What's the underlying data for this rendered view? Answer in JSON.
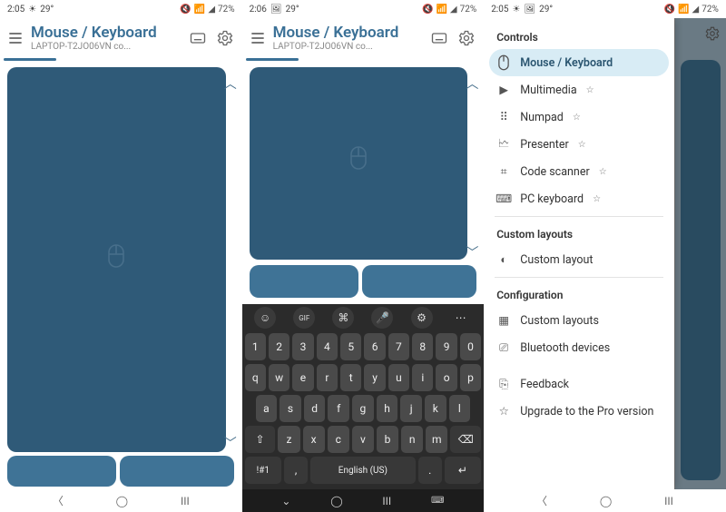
{
  "status": {
    "time_a": "2:05",
    "time_b": "2:06",
    "temp": "29°",
    "battery": "72%"
  },
  "appbar": {
    "title": "Mouse / Keyboard",
    "subtitle": "LAPTOP-T2JO06VN co..."
  },
  "keyboard": {
    "toolbar": [
      "☺",
      "GIF",
      "⌘",
      "🎤",
      "⚙",
      "⋯"
    ],
    "row_num": [
      "1",
      "2",
      "3",
      "4",
      "5",
      "6",
      "7",
      "8",
      "9",
      "0"
    ],
    "row_q": [
      "q",
      "w",
      "e",
      "r",
      "t",
      "y",
      "u",
      "i",
      "o",
      "p"
    ],
    "row_a": [
      "a",
      "s",
      "d",
      "f",
      "g",
      "h",
      "j",
      "k",
      "l"
    ],
    "row_z": [
      "z",
      "x",
      "c",
      "v",
      "b",
      "n",
      "m"
    ],
    "shift": "⇧",
    "back": "⌫",
    "sym": "!#1",
    "comma": ",",
    "space": "English (US)",
    "period": ".",
    "enter": "↵"
  },
  "drawer": {
    "sections": {
      "controls": "Controls",
      "custom_layouts": "Custom layouts",
      "configuration": "Configuration"
    },
    "items": {
      "mouse": "Mouse / Keyboard",
      "multimedia": "Multimedia",
      "numpad": "Numpad",
      "presenter": "Presenter",
      "scanner": "Code scanner",
      "pckb": "PC keyboard",
      "custom_layout": "Custom layout",
      "custom_layouts_cfg": "Custom layouts",
      "bluetooth": "Bluetooth devices",
      "feedback": "Feedback",
      "upgrade": "Upgrade to the Pro version"
    },
    "star": "☆"
  }
}
